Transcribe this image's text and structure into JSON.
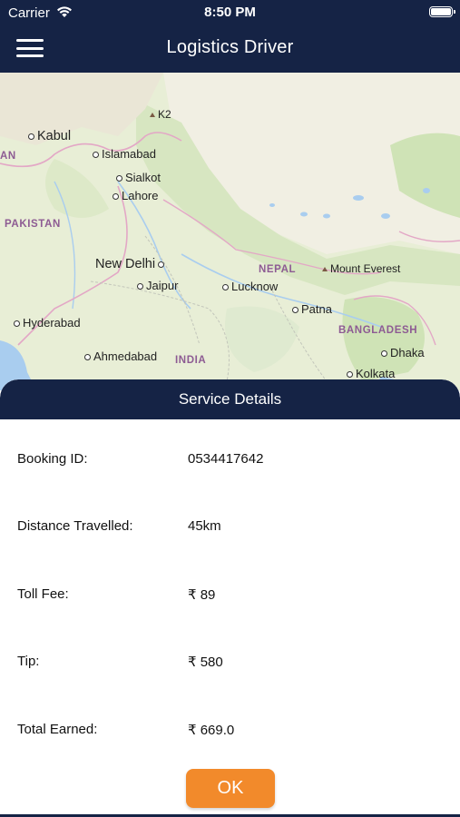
{
  "status_bar": {
    "carrier": "Carrier",
    "time": "8:50 PM",
    "icons": [
      "wifi-icon",
      "battery-icon"
    ]
  },
  "nav": {
    "title": "Logistics Driver",
    "menu_icon": "hamburger-menu-icon"
  },
  "map": {
    "places": {
      "kabul": "Kabul",
      "k2": "K2",
      "islamabad": "Islamabad",
      "sialkot": "Sialkot",
      "lahore": "Lahore",
      "pakistan": "PAKISTAN",
      "an": "AN",
      "new_delhi": "New Delhi",
      "jaipur": "Jaipur",
      "lucknow": "Lucknow",
      "nepal": "NEPAL",
      "mount_everest": "Mount Everest",
      "patna": "Patna",
      "hyderabad": "Hyderabad",
      "bangladesh": "BANGLADESH",
      "ahmedabad": "Ahmedabad",
      "india": "INDIA",
      "dhaka": "Dhaka",
      "kolkata": "Kolkata"
    }
  },
  "service": {
    "header": "Service Details",
    "rows": [
      {
        "label": "Booking ID:",
        "value": "0534417642"
      },
      {
        "label": "Distance Travelled:",
        "value": "45km"
      },
      {
        "label": "Toll Fee:",
        "value": "₹ 89"
      },
      {
        "label": "Tip:",
        "value": "₹ 580"
      },
      {
        "label": "Total Earned:",
        "value": "₹ 669.0"
      }
    ],
    "ok_label": "OK"
  },
  "colors": {
    "navy": "#152345",
    "accent_orange": "#f28a2b"
  }
}
